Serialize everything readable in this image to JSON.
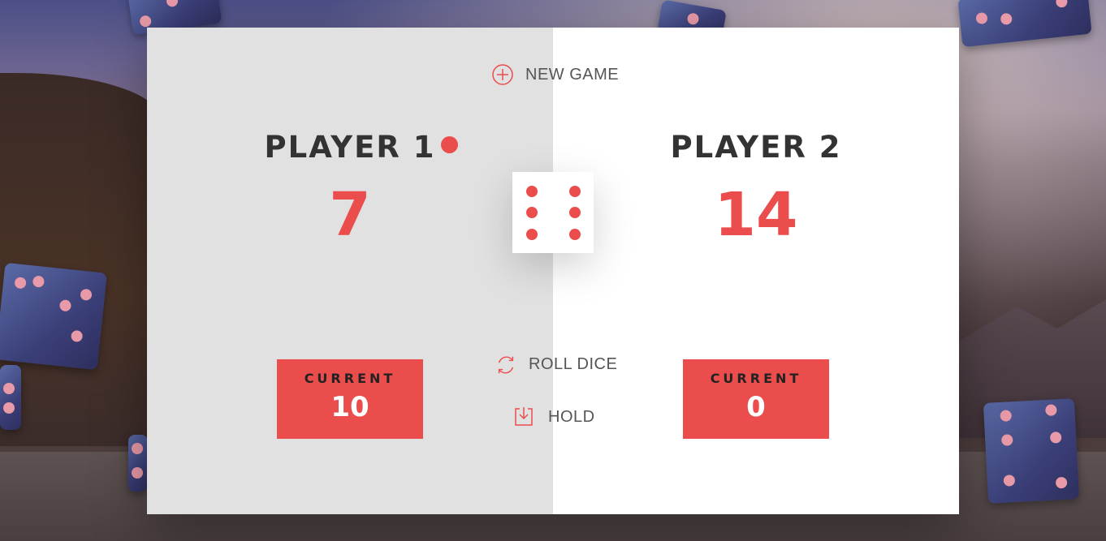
{
  "game": {
    "new_game_label": "NEW GAME",
    "roll_label": "ROLL DICE",
    "hold_label": "HOLD",
    "dice_value": 6,
    "active_player": 1,
    "accent_color": "#eb4d4d"
  },
  "players": [
    {
      "name": "PLAYER 1",
      "score": "7",
      "current_label": "CURRENT",
      "current": "10"
    },
    {
      "name": "PLAYER 2",
      "score": "14",
      "current_label": "CURRENT",
      "current": "0"
    }
  ],
  "icons": {
    "new_game": "plus-circle-icon",
    "roll": "refresh-icon",
    "hold": "download-tray-icon",
    "active": "active-player-dot-icon"
  }
}
